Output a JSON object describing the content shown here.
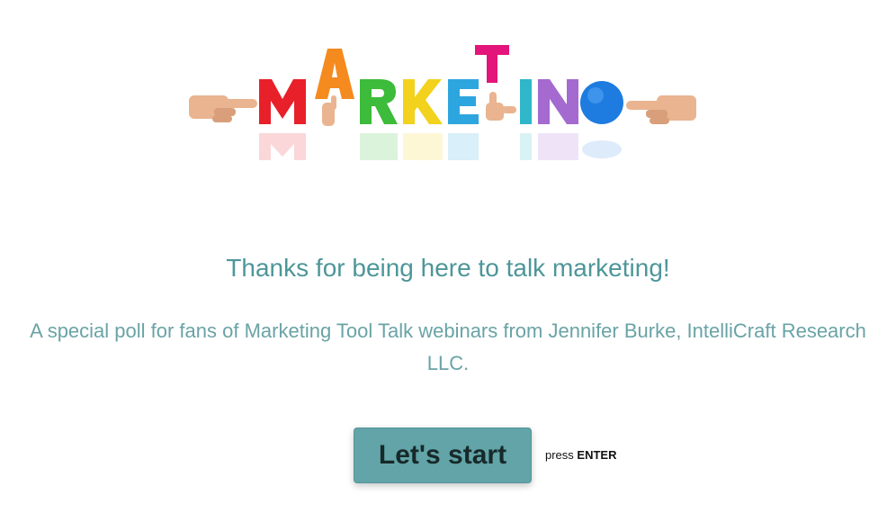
{
  "logo": {
    "alt": "MARKETING",
    "letters": [
      "M",
      "A",
      "R",
      "K",
      "E",
      "T",
      "I",
      "N",
      "G"
    ],
    "colors": [
      "#e8202a",
      "#f58a1f",
      "#3dbb3a",
      "#f2d21c",
      "#2da6df",
      "#e3147a",
      "#2fb7c9",
      "#a46ad0",
      "#1e7be0"
    ]
  },
  "welcome": {
    "title": "Thanks for being here to talk marketing!",
    "subtitle": "A special poll for fans of Marketing Tool Talk webinars from Jennifer Burke, IntelliCraft Research LLC."
  },
  "start": {
    "button_label": "Let's start",
    "hint_prefix": "press",
    "hint_key": "ENTER"
  },
  "colors": {
    "accent": "#62a4a7",
    "title_text": "#4e9699",
    "subtitle_text": "#6aa3a6"
  }
}
